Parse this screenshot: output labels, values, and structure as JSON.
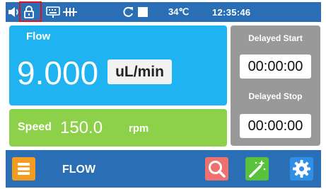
{
  "status_bar": {
    "temperature": "34℃",
    "clock": "12:35:46",
    "icons": [
      "speaker-icon",
      "lock-icon",
      "keyboard-icon",
      "pump-icon",
      "refresh-icon",
      "stop-icon"
    ]
  },
  "flow": {
    "title": "Flow",
    "value": "9.000",
    "unit": "uL/min"
  },
  "speed": {
    "label": "Speed",
    "value": "150.0",
    "unit": "rpm"
  },
  "delay": {
    "start_label": "Delayed Start",
    "start_time": "00:00:00",
    "stop_label": "Delayed Stop",
    "stop_time": "00:00:00"
  },
  "bottom_bar": {
    "mode_label": "FLOW",
    "icons": [
      "menu-icon",
      "search-icon",
      "magic-wand-icon",
      "gear-icon"
    ]
  },
  "colors": {
    "bar": "#2a6fb6",
    "flow_panel": "#1fb3f1",
    "speed_panel": "#8dd04a",
    "delay_panel": "#999999",
    "menu_button": "#f39c1f",
    "search_button": "#f0706e",
    "wand_button": "#58c23c",
    "settings_button": "#2f8fe6",
    "highlight": "#e0141e"
  }
}
